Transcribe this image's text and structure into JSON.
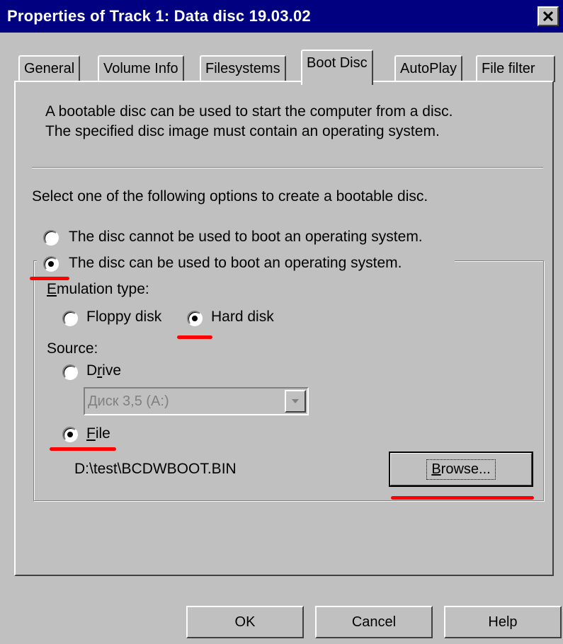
{
  "window": {
    "title": "Properties of Track 1: Data disc 19.03.02",
    "close_glyph": "×"
  },
  "tabs": [
    {
      "label": "General",
      "active": false
    },
    {
      "label": "Volume Info",
      "active": false
    },
    {
      "label": "Filesystems",
      "active": false
    },
    {
      "label": "Boot Disc",
      "active": true
    },
    {
      "label": "AutoPlay",
      "active": false
    },
    {
      "label": "File filter",
      "active": false
    }
  ],
  "intro": {
    "line1": "A bootable disc can be used to start the computer from a disc.",
    "line2": "The specified disc image must contain an operating system."
  },
  "select_prompt": "Select one of the following options to create a bootable disc.",
  "boot_options": {
    "cannot_boot": "The disc cannot be used to boot an operating system.",
    "can_boot": "The disc can be used to boot an operating system.",
    "selected": "can_boot"
  },
  "emulation": {
    "label_first": "E",
    "label_rest": "mulation type:",
    "floppy": "Floppy disk",
    "hard": "Hard disk",
    "selected": "hard"
  },
  "source": {
    "label": "Source:",
    "drive_pre": "D",
    "drive_u": "r",
    "drive_post": "ive",
    "drive_value": "Диск 3,5 (A:)",
    "file_u": "F",
    "file_post": "ile",
    "selected": "file",
    "file_path": "D:\\test\\BCDWBOOT.BIN"
  },
  "buttons": {
    "browse_u": "B",
    "browse_rest": "rowse...",
    "ok": "OK",
    "cancel": "Cancel",
    "help": "Help"
  },
  "colors": {
    "title_bar": "#000080",
    "face": "#c0c0c0",
    "annotation": "#ff0000"
  }
}
